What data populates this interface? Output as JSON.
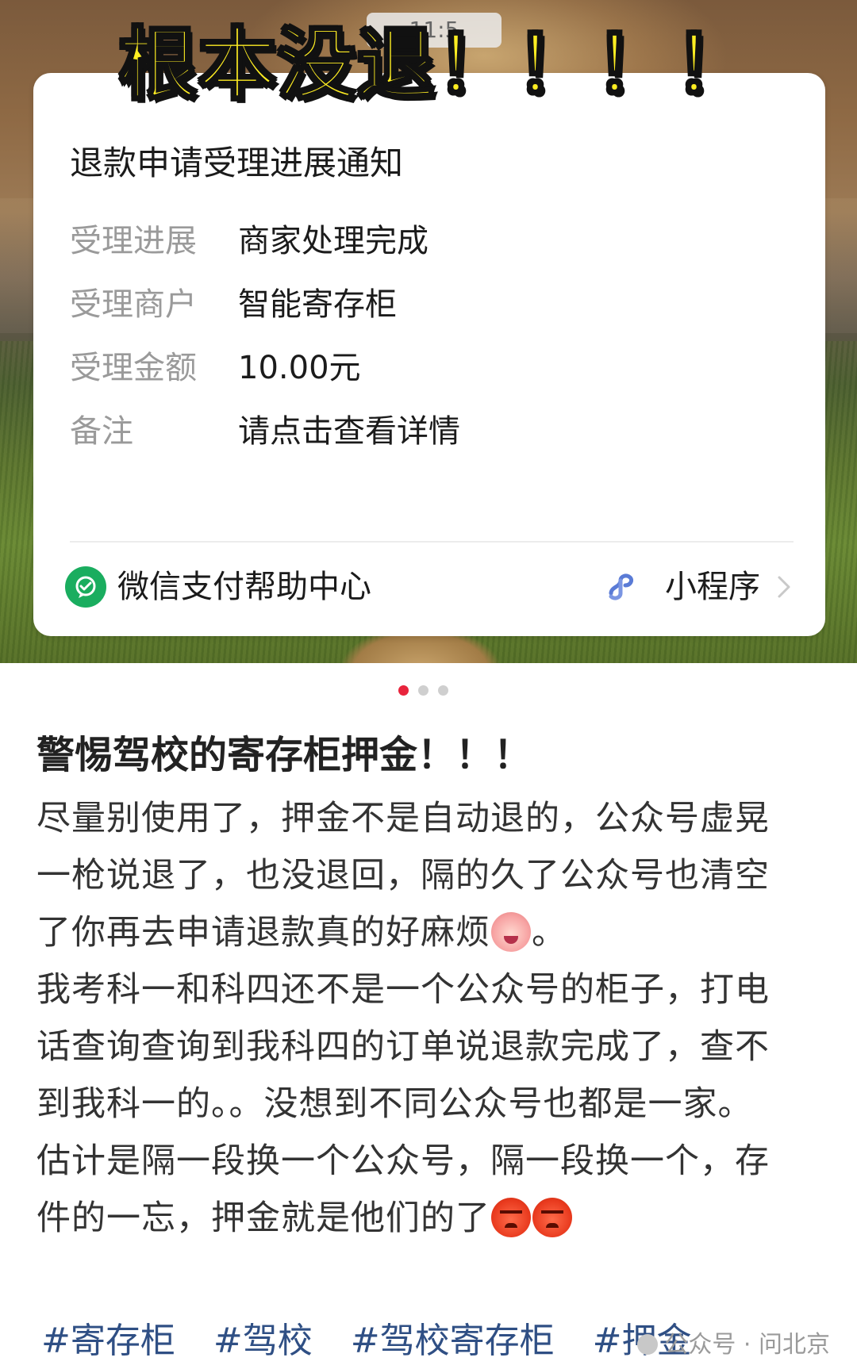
{
  "hero": {
    "banner_text": "根本没退！！！！",
    "status_time": "11:5"
  },
  "notification": {
    "title": "退款申请受理进展通知",
    "rows": [
      {
        "label": "受理进展",
        "value": "商家处理完成"
      },
      {
        "label": "受理商户",
        "value": "智能寄存柜"
      },
      {
        "label": "受理金额",
        "value": "10.00元"
      },
      {
        "label": "备注",
        "value": "请点击查看详情"
      }
    ],
    "footer": {
      "account_name": "微信支付帮助中心",
      "account_icon": "wechat-pay-help-icon",
      "mini_program_label": "小程序",
      "mini_program_icon": "mini-program-link-icon"
    }
  },
  "carousel": {
    "count": 3,
    "active_index": 0,
    "active_color": "#e8243c"
  },
  "post": {
    "title": "警惕驾校的寄存柜押金！！！",
    "lines": [
      "尽量别使用了，押金不是自动退的，公众号虚晃",
      "一枪说退了，也没退回，隔的久了公众号也清空",
      "了你再去申请退款真的好麻烦",
      "我考科一和科四还不是一个公众号的柜子，打电",
      "话查询查询到我科四的订单说退款完成了，查不",
      "到我科一的。。没想到不同公众号也都是一家。",
      "估计是隔一段换一个公众号，隔一段换一个，存",
      "件的一忘，押金就是他们的了"
    ],
    "line3_suffix": "。",
    "tags": [
      "#寄存柜",
      "#驾校",
      "#驾校寄存柜",
      "#押金"
    ]
  },
  "watermark": {
    "text": "公众号 · 问北京"
  }
}
